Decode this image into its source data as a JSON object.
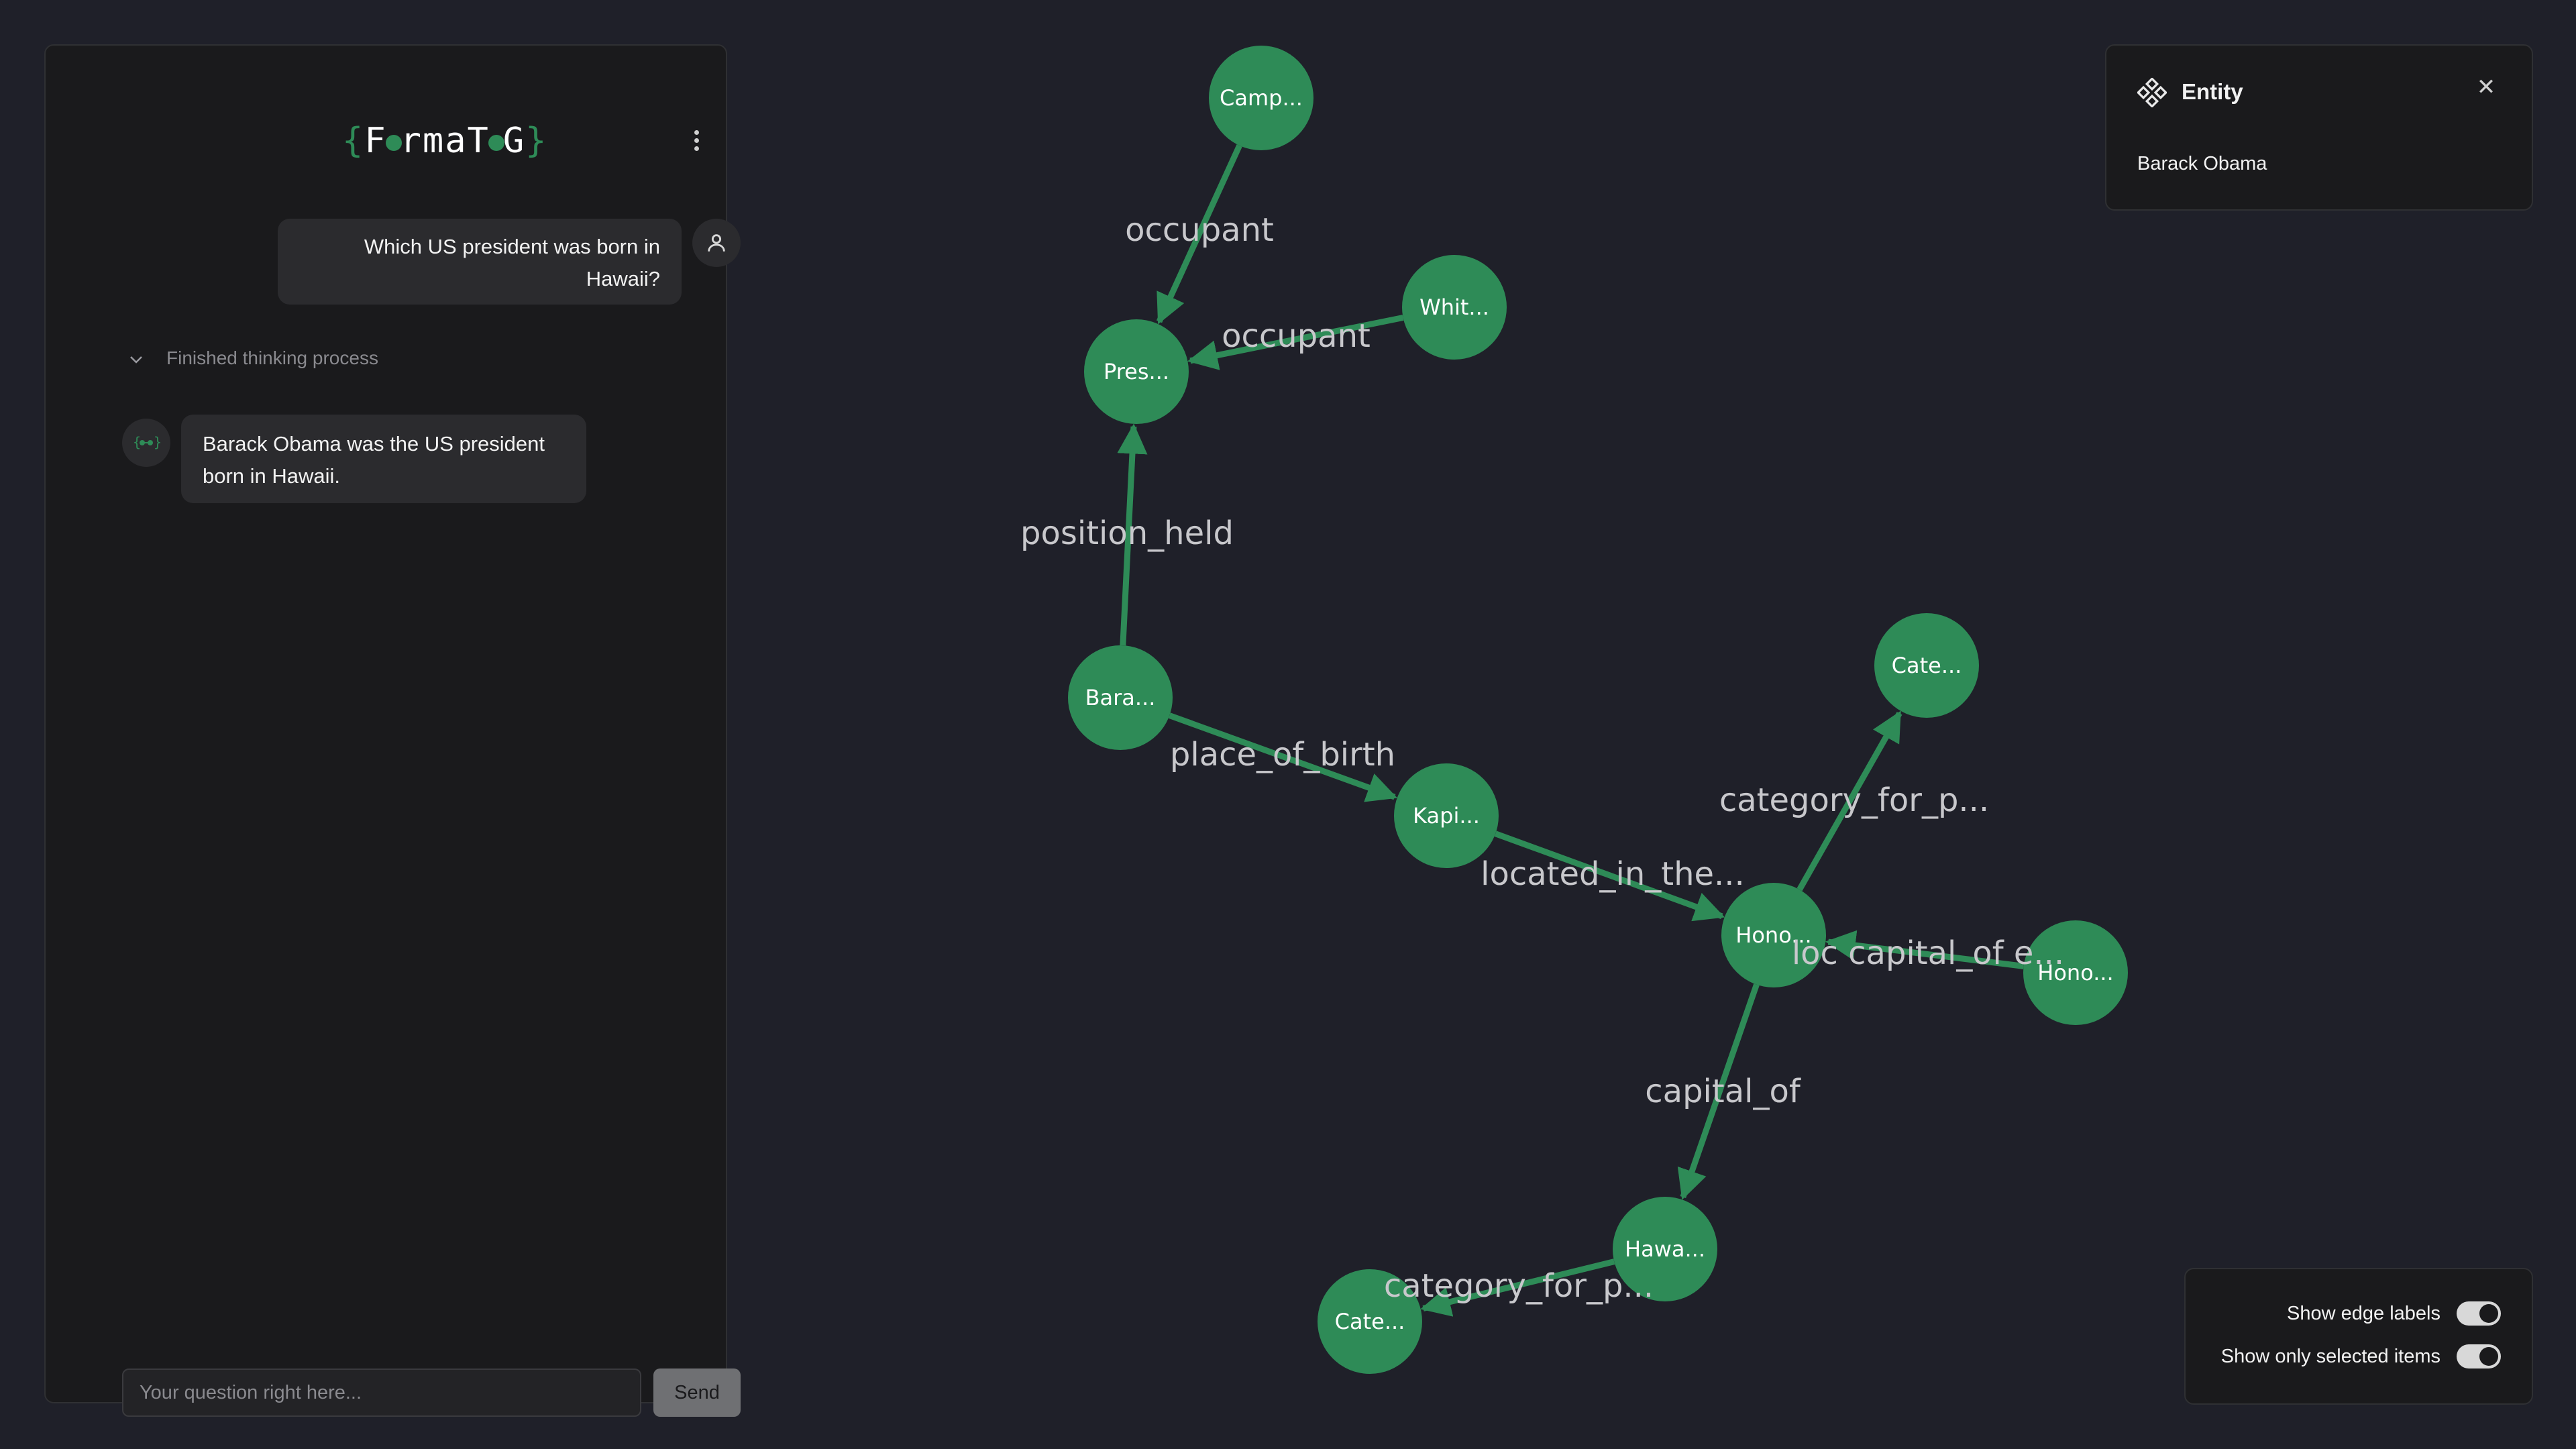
{
  "app": {
    "logo_text": [
      "F",
      "rmaT",
      "G"
    ]
  },
  "chat": {
    "user_message": "Which US president was born in Hawaii?",
    "thinking_label": "Finished thinking process",
    "bot_message": "Barack Obama was the US president born in Hawaii.",
    "input_placeholder": "Your question right here...",
    "send_label": "Send"
  },
  "entity_panel": {
    "title": "Entity",
    "value": "Barack Obama"
  },
  "toggles": {
    "show_edge_labels": {
      "label": "Show edge labels",
      "on": true
    },
    "show_only_selected": {
      "label": "Show only selected items",
      "on": true
    }
  },
  "graph": {
    "node_color": "#2e8b57",
    "nodes": [
      {
        "id": "camp",
        "label": "Camp..."
      },
      {
        "id": "whit",
        "label": "Whit..."
      },
      {
        "id": "pres",
        "label": "Pres..."
      },
      {
        "id": "bara",
        "label": "Bara..."
      },
      {
        "id": "kapi",
        "label": "Kapi..."
      },
      {
        "id": "hono1",
        "label": "Hono..."
      },
      {
        "id": "cate1",
        "label": "Cate..."
      },
      {
        "id": "hono2",
        "label": "Hono..."
      },
      {
        "id": "hawa",
        "label": "Hawa..."
      },
      {
        "id": "cate2",
        "label": "Cate..."
      }
    ],
    "edges": [
      {
        "from": "camp",
        "to": "pres",
        "label": "occupant"
      },
      {
        "from": "whit",
        "to": "pres",
        "label": "occupant"
      },
      {
        "from": "bara",
        "to": "pres",
        "label": "position_held"
      },
      {
        "from": "bara",
        "to": "kapi",
        "label": "place_of_birth"
      },
      {
        "from": "kapi",
        "to": "hono1",
        "label": "located_in_the..."
      },
      {
        "from": "hono1",
        "to": "cate1",
        "label": "category_for_p..."
      },
      {
        "from": "hono2",
        "to": "hono1",
        "label": "loc capital_of e..."
      },
      {
        "from": "hono1",
        "to": "hawa",
        "label": "capital_of"
      },
      {
        "from": "hawa",
        "to": "cate2",
        "label": "category_for_p..."
      }
    ]
  }
}
